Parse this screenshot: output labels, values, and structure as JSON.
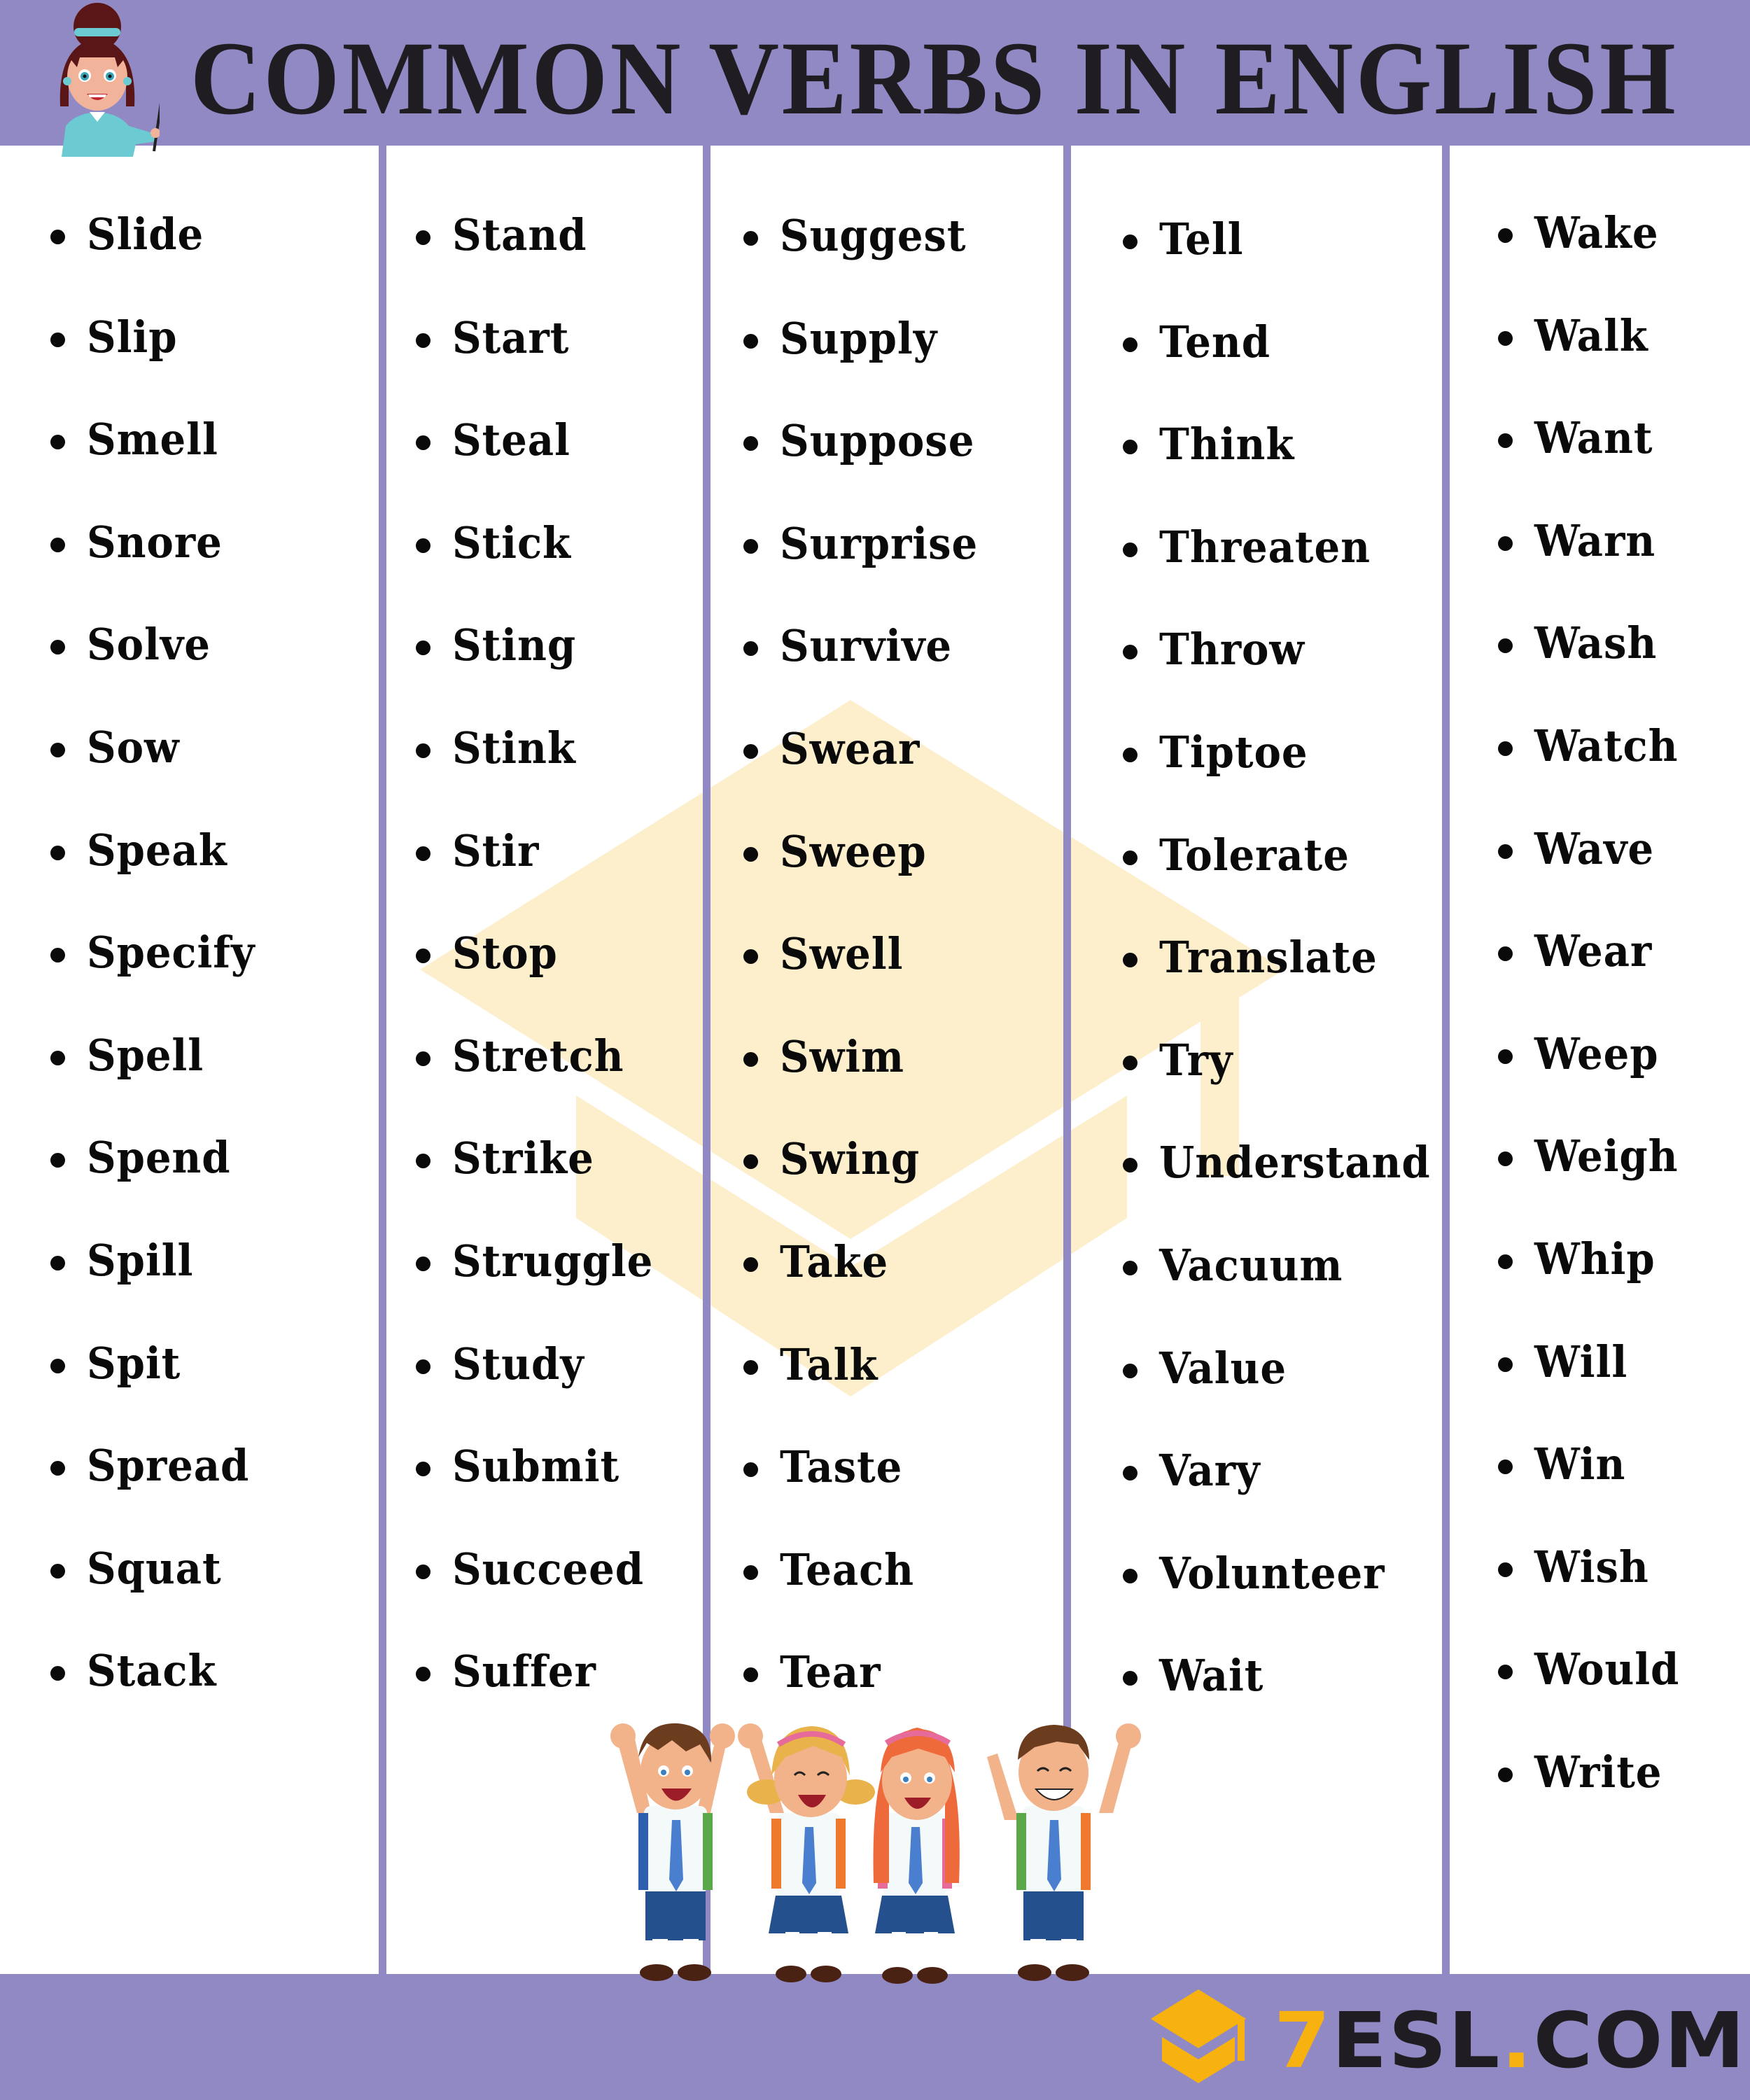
{
  "header": {
    "title": "COMMON VERBS IN ENGLISH",
    "illustration": "teacher-with-pointer"
  },
  "colors": {
    "band": "#9189c4",
    "text": "#0a0a0a",
    "title_text": "#1f1d22",
    "watermark": "#fdefcc",
    "logo_accent": "#f7b210"
  },
  "columns": [
    {
      "items": [
        "Slide",
        "Slip",
        "Smell",
        "Snore",
        "Solve",
        "Sow",
        "Speak",
        "Specify",
        "Spell",
        "Spend",
        "Spill",
        "Spit",
        "Spread",
        "Squat",
        "Stack"
      ]
    },
    {
      "items": [
        "Stand",
        "Start",
        "Steal",
        "Stick",
        "Sting",
        "Stink",
        "Stir",
        "Stop",
        "Stretch",
        "Strike",
        "Struggle",
        "Study",
        "Submit",
        "Succeed",
        "Suffer"
      ]
    },
    {
      "items": [
        "Suggest",
        "Supply",
        "Suppose",
        "Surprise",
        "Survive",
        "Swear",
        "Sweep",
        "Swell",
        "Swim",
        "Swing",
        "Take",
        "Talk",
        "Taste",
        "Teach",
        "Tear"
      ]
    },
    {
      "items": [
        "Tell",
        "Tend",
        "Think",
        "Threaten",
        "Throw",
        "Tiptoe",
        "Tolerate",
        "Translate",
        "Try",
        "Understand",
        "Vacuum",
        "Value",
        "Vary",
        "Volunteer",
        "Wait"
      ]
    },
    {
      "items": [
        "Wake",
        "Walk",
        "Want",
        "Warn",
        "Wash",
        "Watch",
        "Wave",
        "Wear",
        "Weep",
        "Weigh",
        "Whip",
        "Will",
        "Win",
        "Wish",
        "Would",
        "Write"
      ]
    }
  ],
  "footer": {
    "illustration": "four-school-kids-cheering",
    "logo": {
      "icon": "graduation-cap-icon",
      "prefix": "7",
      "name": "ESL",
      "dot": ".",
      "suffix": "COM"
    }
  }
}
